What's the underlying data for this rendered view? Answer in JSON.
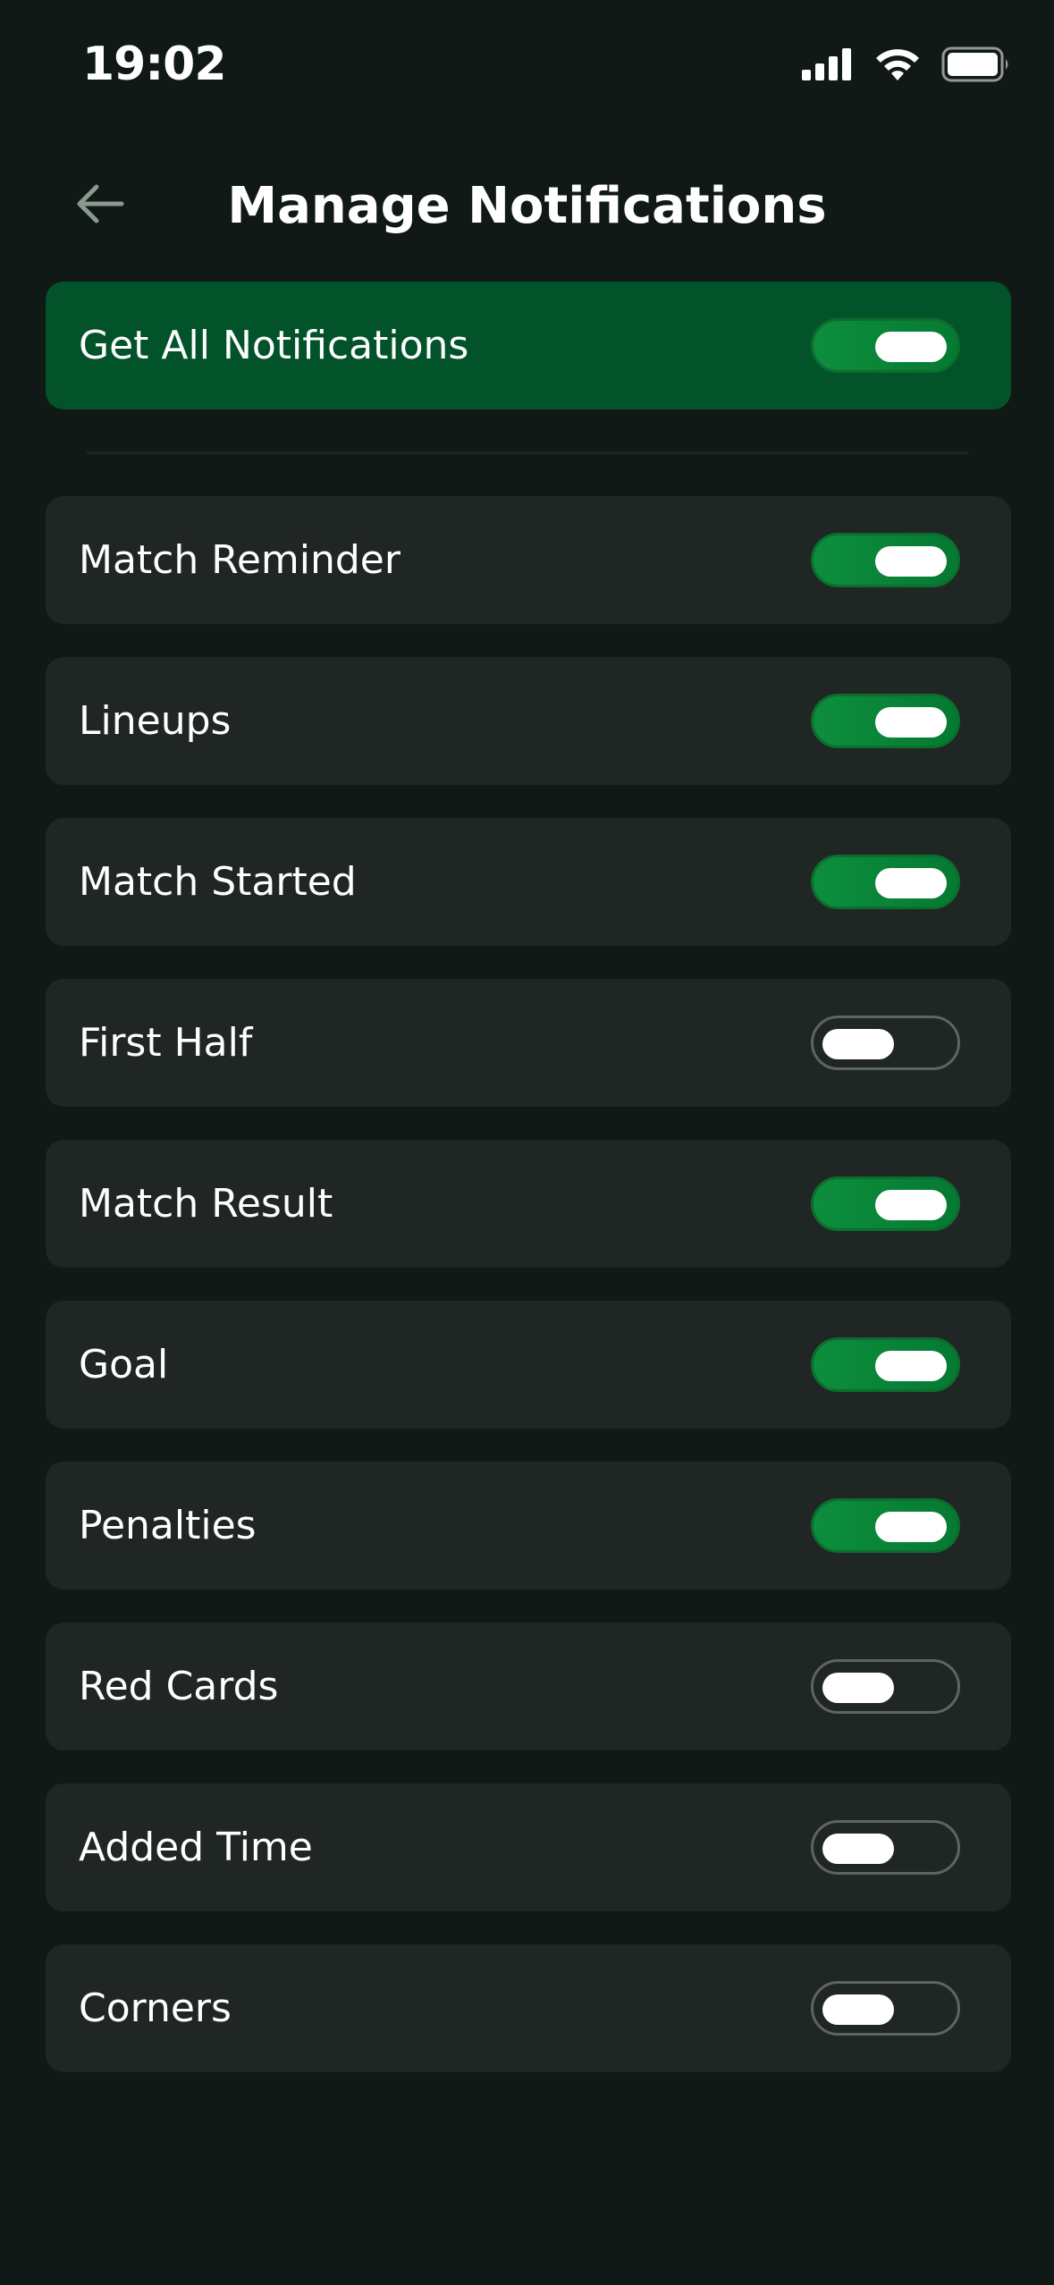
{
  "status_bar": {
    "time": "19:02",
    "icons": [
      "cellular-signal-icon",
      "wifi-icon",
      "battery-icon"
    ]
  },
  "header": {
    "title": "Manage Notifications",
    "back_icon": "arrow-left-icon"
  },
  "colors": {
    "background": "#101915",
    "row_background": "#1f2623",
    "master_background": "#02522a",
    "toggle_on": "#0d8e3d",
    "toggle_off_border": "#5d6562",
    "back_arrow": "#8a9a90"
  },
  "master": {
    "label": "Get All Notifications",
    "enabled": true
  },
  "items": [
    {
      "label": "Match Reminder",
      "enabled": true
    },
    {
      "label": "Lineups",
      "enabled": true
    },
    {
      "label": "Match Started",
      "enabled": true
    },
    {
      "label": "First Half",
      "enabled": false
    },
    {
      "label": "Match Result",
      "enabled": true
    },
    {
      "label": "Goal",
      "enabled": true
    },
    {
      "label": "Penalties",
      "enabled": true
    },
    {
      "label": "Red Cards",
      "enabled": false
    },
    {
      "label": "Added Time",
      "enabled": false
    },
    {
      "label": "Corners",
      "enabled": false
    }
  ]
}
